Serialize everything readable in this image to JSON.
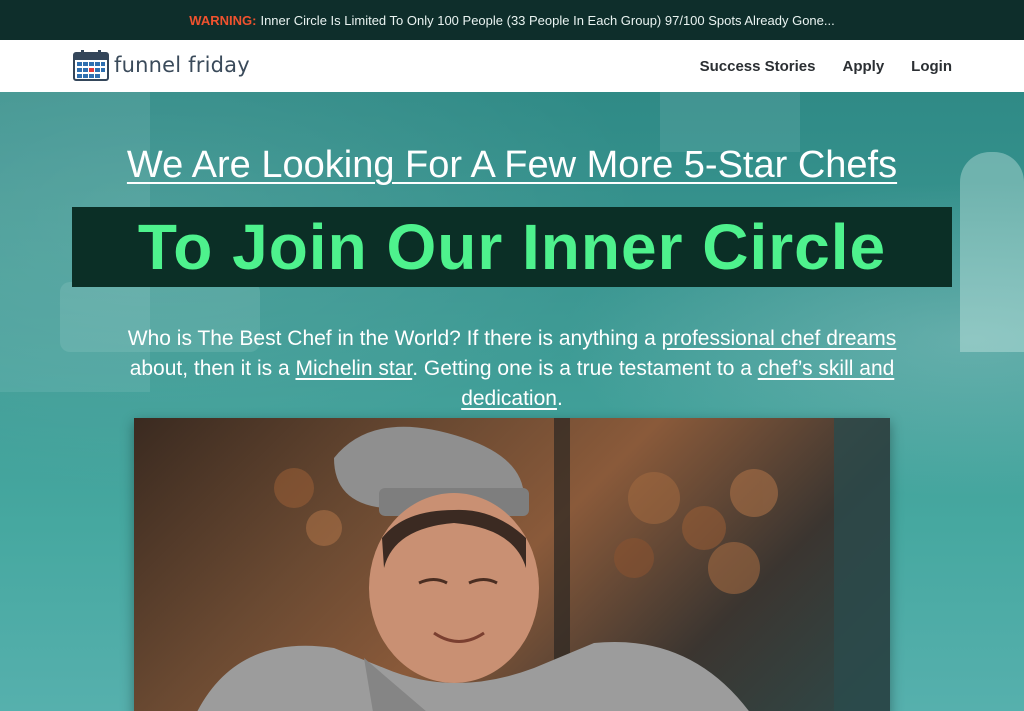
{
  "warning": {
    "label": "WARNING:",
    "text": "Inner Circle Is Limited To Only 100 People (33 People In Each Group) 97/100 Spots Already Gone..."
  },
  "brand": {
    "name": "funnel friday",
    "icon": "calendar-icon"
  },
  "nav": {
    "items": [
      {
        "label": "Success Stories"
      },
      {
        "label": "Apply"
      },
      {
        "label": "Login"
      }
    ]
  },
  "hero": {
    "headline": "We Are Looking For A Few More 5-Star Chefs",
    "subheadline": "To Join Our Inner Circle",
    "intro": {
      "part1": "Who is The Best Chef in the World? If there is anything a ",
      "link1": "professional chef dreams",
      "part2": " about, then it is a ",
      "link2": "Michelin star",
      "part3": ". Getting one is a true testament to a ",
      "link3": "chef’s skill and dedication",
      "part4": "."
    }
  },
  "colors": {
    "warning_bg": "#0e2e2b",
    "warning_accent": "#f0522e",
    "headline_green": "#4ef28d",
    "hero_teal": "#3d9a94"
  }
}
